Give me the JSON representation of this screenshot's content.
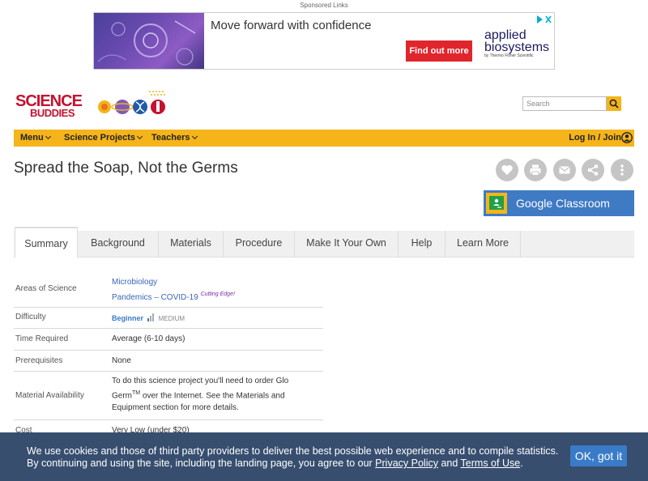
{
  "ad": {
    "sponsored_label": "Sponsored Links",
    "headline": "Move forward with confidence",
    "cta": "Find out more",
    "brand_line1": "applied",
    "brand_line2": "biosystems",
    "brand_line3": "by Thermo Fisher Scientific"
  },
  "header": {
    "logo_line1": "SCIENCE",
    "logo_line2": "BUDDIES",
    "search_placeholder": "Search"
  },
  "nav": {
    "items": [
      "Menu",
      "Science Projects",
      "Teachers"
    ],
    "login": "Log In / Join"
  },
  "page": {
    "title": "Spread the Soap, Not the Germs",
    "actions": [
      "heart-icon",
      "print-icon",
      "mail-icon",
      "share-icon",
      "more-icon"
    ],
    "classroom_button": "Google Classroom"
  },
  "tabs": [
    "Summary",
    "Background",
    "Materials",
    "Procedure",
    "Make It Your Own",
    "Help",
    "Learn More"
  ],
  "summary": {
    "areas_label": "Areas of Science",
    "area1": "Microbiology",
    "area2": "Pandemics – COVID-19",
    "area2_badge": "Cutting Edge!",
    "difficulty_label": "Difficulty",
    "difficulty_value": "Beginner",
    "difficulty_level": "MEDIUM",
    "time_label": "Time Required",
    "time_value": "Average (6-10 days)",
    "prereq_label": "Prerequisites",
    "prereq_value": "None",
    "material_label": "Material Availability",
    "material_value_a": "To do this science project you'll need to order Glo Germ",
    "material_value_tm": "TM",
    "material_value_b": " over the Internet. See the Materials and Equipment section for more details.",
    "cost_label": "Cost",
    "cost_value": "Very Low (under $20)"
  },
  "cookie": {
    "text_a": "We use cookies and those of third party providers to deliver the best possible web experience and to compile statistics. By continuing and using the site, including the landing page, you agree to our ",
    "privacy": "Privacy Policy",
    "and": " and ",
    "terms": "Terms of Use",
    "period": ".",
    "ok": "OK, got it"
  },
  "colors": {
    "accent": "#f4b41a",
    "link": "#3a66b7",
    "classroom": "#3f7ac5",
    "cookie_bg": "#284164",
    "ad_cta": "#e0262c"
  }
}
